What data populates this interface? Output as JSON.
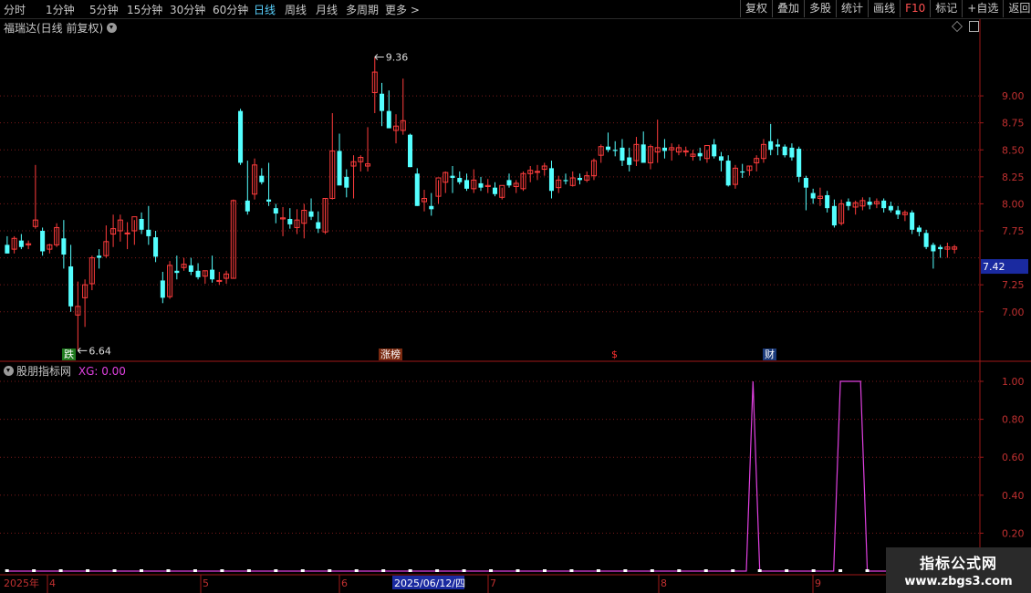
{
  "toolbar": {
    "periods": [
      "分时",
      "1分钟",
      "5分钟",
      "15分钟",
      "30分钟",
      "60分钟",
      "日线",
      "周线",
      "月线",
      "多周期",
      "更多 >"
    ],
    "active_period": "日线",
    "right_buttons": [
      "复权",
      "叠加",
      "多股",
      "统计",
      "画线",
      "F10",
      "标记",
      "+自选",
      "返回"
    ]
  },
  "stock": {
    "title": "福瑞达(日线 前复权)",
    "max_label": "9.36",
    "min_label": "6.64",
    "last_price": "7.42"
  },
  "events": [
    {
      "label": "跌",
      "color": "#ffffff",
      "bg": "#1e7a1e"
    },
    {
      "label": "涨榜",
      "color": "#ffffff",
      "bg": "#7a2a10"
    },
    {
      "label": "$",
      "color": "#ff3030",
      "bg": "transparent"
    },
    {
      "label": "财",
      "color": "#ffffff",
      "bg": "#1a3a7a"
    }
  ],
  "indicator": {
    "name": "股朋指标网",
    "value_text": "XG: 0.00",
    "yticks": [
      "1.00",
      "0.80",
      "0.60",
      "0.40",
      "0.20"
    ]
  },
  "price_axis": {
    "yticks": [
      "9.00",
      "8.75",
      "8.50",
      "8.25",
      "8.00",
      "7.75",
      "7.25",
      "7.00"
    ]
  },
  "date_axis": {
    "year": "2025年",
    "months": [
      "4",
      "5",
      "6",
      "7",
      "8",
      "9"
    ],
    "cursor_date": "2025/06/12/四"
  },
  "watermark": {
    "line1": "指标公式网",
    "line2": "www.zbgs3.com"
  },
  "colors": {
    "up": "#ff3c3c",
    "down": "#54ffff",
    "grid": "#7a1a1a",
    "axis": "#a01818",
    "xg": "#e040e0"
  },
  "chart_data": {
    "type": "candlestick",
    "ylim": [
      6.55,
      9.55
    ],
    "ohlc": [
      [
        7.62,
        7.7,
        7.54,
        7.54
      ],
      [
        7.58,
        7.7,
        7.54,
        7.68
      ],
      [
        7.66,
        7.72,
        7.58,
        7.6
      ],
      [
        7.62,
        7.66,
        7.58,
        7.63
      ],
      [
        7.79,
        8.36,
        7.77,
        7.85
      ],
      [
        7.75,
        7.78,
        7.52,
        7.56
      ],
      [
        7.58,
        7.63,
        7.54,
        7.62
      ],
      [
        7.62,
        7.82,
        7.6,
        7.78
      ],
      [
        7.68,
        7.85,
        7.4,
        7.53
      ],
      [
        7.42,
        7.62,
        7.0,
        7.05
      ],
      [
        6.97,
        7.28,
        6.64,
        7.05
      ],
      [
        7.13,
        7.3,
        6.86,
        7.25
      ],
      [
        7.26,
        7.52,
        7.2,
        7.5
      ],
      [
        7.52,
        7.58,
        7.4,
        7.5
      ],
      [
        7.52,
        7.8,
        7.5,
        7.65
      ],
      [
        7.72,
        7.9,
        7.6,
        7.77
      ],
      [
        7.75,
        7.9,
        7.65,
        7.85
      ],
      [
        7.73,
        7.83,
        7.58,
        7.73
      ],
      [
        7.75,
        7.85,
        7.62,
        7.88
      ],
      [
        7.86,
        7.92,
        7.72,
        7.76
      ],
      [
        7.76,
        7.98,
        7.62,
        7.7
      ],
      [
        7.69,
        7.75,
        7.46,
        7.51
      ],
      [
        7.29,
        7.37,
        7.08,
        7.13
      ],
      [
        7.14,
        7.47,
        7.12,
        7.43
      ],
      [
        7.38,
        7.52,
        7.3,
        7.36
      ],
      [
        7.41,
        7.5,
        7.38,
        7.44
      ],
      [
        7.43,
        7.5,
        7.34,
        7.37
      ],
      [
        7.38,
        7.45,
        7.3,
        7.32
      ],
      [
        7.33,
        7.38,
        7.26,
        7.38
      ],
      [
        7.39,
        7.52,
        7.27,
        7.3
      ],
      [
        7.29,
        7.37,
        7.25,
        7.29
      ],
      [
        7.31,
        7.38,
        7.26,
        7.35
      ],
      [
        7.31,
        8.04,
        7.31,
        8.03
      ],
      [
        8.86,
        8.88,
        8.36,
        8.38
      ],
      [
        8.03,
        8.4,
        7.9,
        7.93
      ],
      [
        8.09,
        8.42,
        8.04,
        8.36
      ],
      [
        8.26,
        8.33,
        8.18,
        8.2
      ],
      [
        8.04,
        8.38,
        7.98,
        8.02
      ],
      [
        7.96,
        8.0,
        7.82,
        7.91
      ],
      [
        7.86,
        7.97,
        7.7,
        7.87
      ],
      [
        7.86,
        7.96,
        7.77,
        7.81
      ],
      [
        7.78,
        7.95,
        7.72,
        7.85
      ],
      [
        7.82,
        8.0,
        7.68,
        7.94
      ],
      [
        7.93,
        8.05,
        7.85,
        7.88
      ],
      [
        7.83,
        7.93,
        7.73,
        7.77
      ],
      [
        7.74,
        8.05,
        7.72,
        8.05
      ],
      [
        8.05,
        8.84,
        8.04,
        8.49
      ],
      [
        8.49,
        8.65,
        8.27,
        8.17
      ],
      [
        8.25,
        8.32,
        8.06,
        8.15
      ],
      [
        8.35,
        8.45,
        8.05,
        8.39
      ],
      [
        8.39,
        8.45,
        8.3,
        8.43
      ],
      [
        8.35,
        8.71,
        8.3,
        8.37
      ],
      [
        9.03,
        9.36,
        8.84,
        9.22
      ],
      [
        9.02,
        9.12,
        8.72,
        8.86
      ],
      [
        8.86,
        9.05,
        8.75,
        8.7
      ],
      [
        8.68,
        8.83,
        8.56,
        8.72
      ],
      [
        8.68,
        9.16,
        8.64,
        8.77
      ],
      [
        8.64,
        8.65,
        8.34,
        8.34
      ],
      [
        8.28,
        8.33,
        7.98,
        7.98
      ],
      [
        8.02,
        8.13,
        7.93,
        8.05
      ],
      [
        7.98,
        8.1,
        7.89,
        7.95
      ],
      [
        8.07,
        8.22,
        8.0,
        8.24
      ],
      [
        8.2,
        8.3,
        8.1,
        8.29
      ],
      [
        8.26,
        8.35,
        8.1,
        8.24
      ],
      [
        8.24,
        8.3,
        8.18,
        8.2
      ],
      [
        8.22,
        8.28,
        8.12,
        8.14
      ],
      [
        8.14,
        8.32,
        8.1,
        8.22
      ],
      [
        8.19,
        8.25,
        8.12,
        8.15
      ],
      [
        8.16,
        8.23,
        8.1,
        8.17
      ],
      [
        8.15,
        8.2,
        8.07,
        8.09
      ],
      [
        8.06,
        8.15,
        8.04,
        8.17
      ],
      [
        8.22,
        8.28,
        8.15,
        8.17
      ],
      [
        8.16,
        8.22,
        8.1,
        8.19
      ],
      [
        8.14,
        8.3,
        8.12,
        8.28
      ],
      [
        8.28,
        8.35,
        8.2,
        8.31
      ],
      [
        8.3,
        8.36,
        8.22,
        8.3
      ],
      [
        8.32,
        8.38,
        8.26,
        8.35
      ],
      [
        8.33,
        8.4,
        8.05,
        8.12
      ],
      [
        8.15,
        8.26,
        8.1,
        8.22
      ],
      [
        8.22,
        8.28,
        8.18,
        8.21
      ],
      [
        8.17,
        8.3,
        8.16,
        8.24
      ],
      [
        8.24,
        8.28,
        8.18,
        8.22
      ],
      [
        8.22,
        8.3,
        8.2,
        8.26
      ],
      [
        8.26,
        8.42,
        8.22,
        8.4
      ],
      [
        8.45,
        8.55,
        8.38,
        8.53
      ],
      [
        8.53,
        8.66,
        8.48,
        8.5
      ],
      [
        8.5,
        8.58,
        8.44,
        8.49
      ],
      [
        8.52,
        8.6,
        8.35,
        8.4
      ],
      [
        8.43,
        8.52,
        8.3,
        8.36
      ],
      [
        8.4,
        8.62,
        8.35,
        8.55
      ],
      [
        8.55,
        8.67,
        8.4,
        8.38
      ],
      [
        8.38,
        8.55,
        8.32,
        8.53
      ],
      [
        8.48,
        8.78,
        8.38,
        8.52
      ],
      [
        8.52,
        8.6,
        8.42,
        8.49
      ],
      [
        8.5,
        8.56,
        8.4,
        8.52
      ],
      [
        8.48,
        8.55,
        8.45,
        8.52
      ],
      [
        8.48,
        8.53,
        8.44,
        8.49
      ],
      [
        8.44,
        8.5,
        8.4,
        8.46
      ],
      [
        8.47,
        8.52,
        8.4,
        8.44
      ],
      [
        8.42,
        8.5,
        8.38,
        8.54
      ],
      [
        8.55,
        8.6,
        8.42,
        8.44
      ],
      [
        8.44,
        8.48,
        8.3,
        8.4
      ],
      [
        8.4,
        8.45,
        8.16,
        8.17
      ],
      [
        8.18,
        8.36,
        8.14,
        8.33
      ],
      [
        8.3,
        8.37,
        8.24,
        8.29
      ],
      [
        8.31,
        8.35,
        8.26,
        8.35
      ],
      [
        8.38,
        8.45,
        8.3,
        8.42
      ],
      [
        8.42,
        8.6,
        8.38,
        8.55
      ],
      [
        8.58,
        8.74,
        8.45,
        8.5
      ],
      [
        8.55,
        8.6,
        8.45,
        8.53
      ],
      [
        8.53,
        8.55,
        8.43,
        8.45
      ],
      [
        8.52,
        8.56,
        8.4,
        8.43
      ],
      [
        8.51,
        8.53,
        8.2,
        8.25
      ],
      [
        8.24,
        8.26,
        7.94,
        8.15
      ],
      [
        8.1,
        8.14,
        8.0,
        8.05
      ],
      [
        8.05,
        8.15,
        7.98,
        8.07
      ],
      [
        8.08,
        8.12,
        7.92,
        7.96
      ],
      [
        7.98,
        8.04,
        7.78,
        7.8
      ],
      [
        7.82,
        8.04,
        7.8,
        8.0
      ],
      [
        8.02,
        8.05,
        7.94,
        7.98
      ],
      [
        7.97,
        8.03,
        7.9,
        8.01
      ],
      [
        7.98,
        8.06,
        7.94,
        8.03
      ],
      [
        8.02,
        8.06,
        7.95,
        7.99
      ],
      [
        8.0,
        8.05,
        7.96,
        8.02
      ],
      [
        8.03,
        8.05,
        7.92,
        7.96
      ],
      [
        7.98,
        8.02,
        7.92,
        7.94
      ],
      [
        7.94,
        7.98,
        7.86,
        7.9
      ],
      [
        7.9,
        7.94,
        7.84,
        7.92
      ],
      [
        7.92,
        7.94,
        7.72,
        7.76
      ],
      [
        7.78,
        7.8,
        7.7,
        7.74
      ],
      [
        7.73,
        7.76,
        7.58,
        7.6
      ],
      [
        7.62,
        7.64,
        7.4,
        7.56
      ],
      [
        7.6,
        7.62,
        7.5,
        7.58
      ],
      [
        7.58,
        7.64,
        7.5,
        7.6
      ],
      [
        7.58,
        7.62,
        7.54,
        7.6
      ]
    ],
    "xg": {
      "n": 142,
      "spikes": [
        [
          111,
          1
        ],
        [
          124,
          1
        ],
        [
          125,
          1
        ],
        [
          126,
          1
        ],
        [
          127,
          1
        ]
      ]
    }
  }
}
